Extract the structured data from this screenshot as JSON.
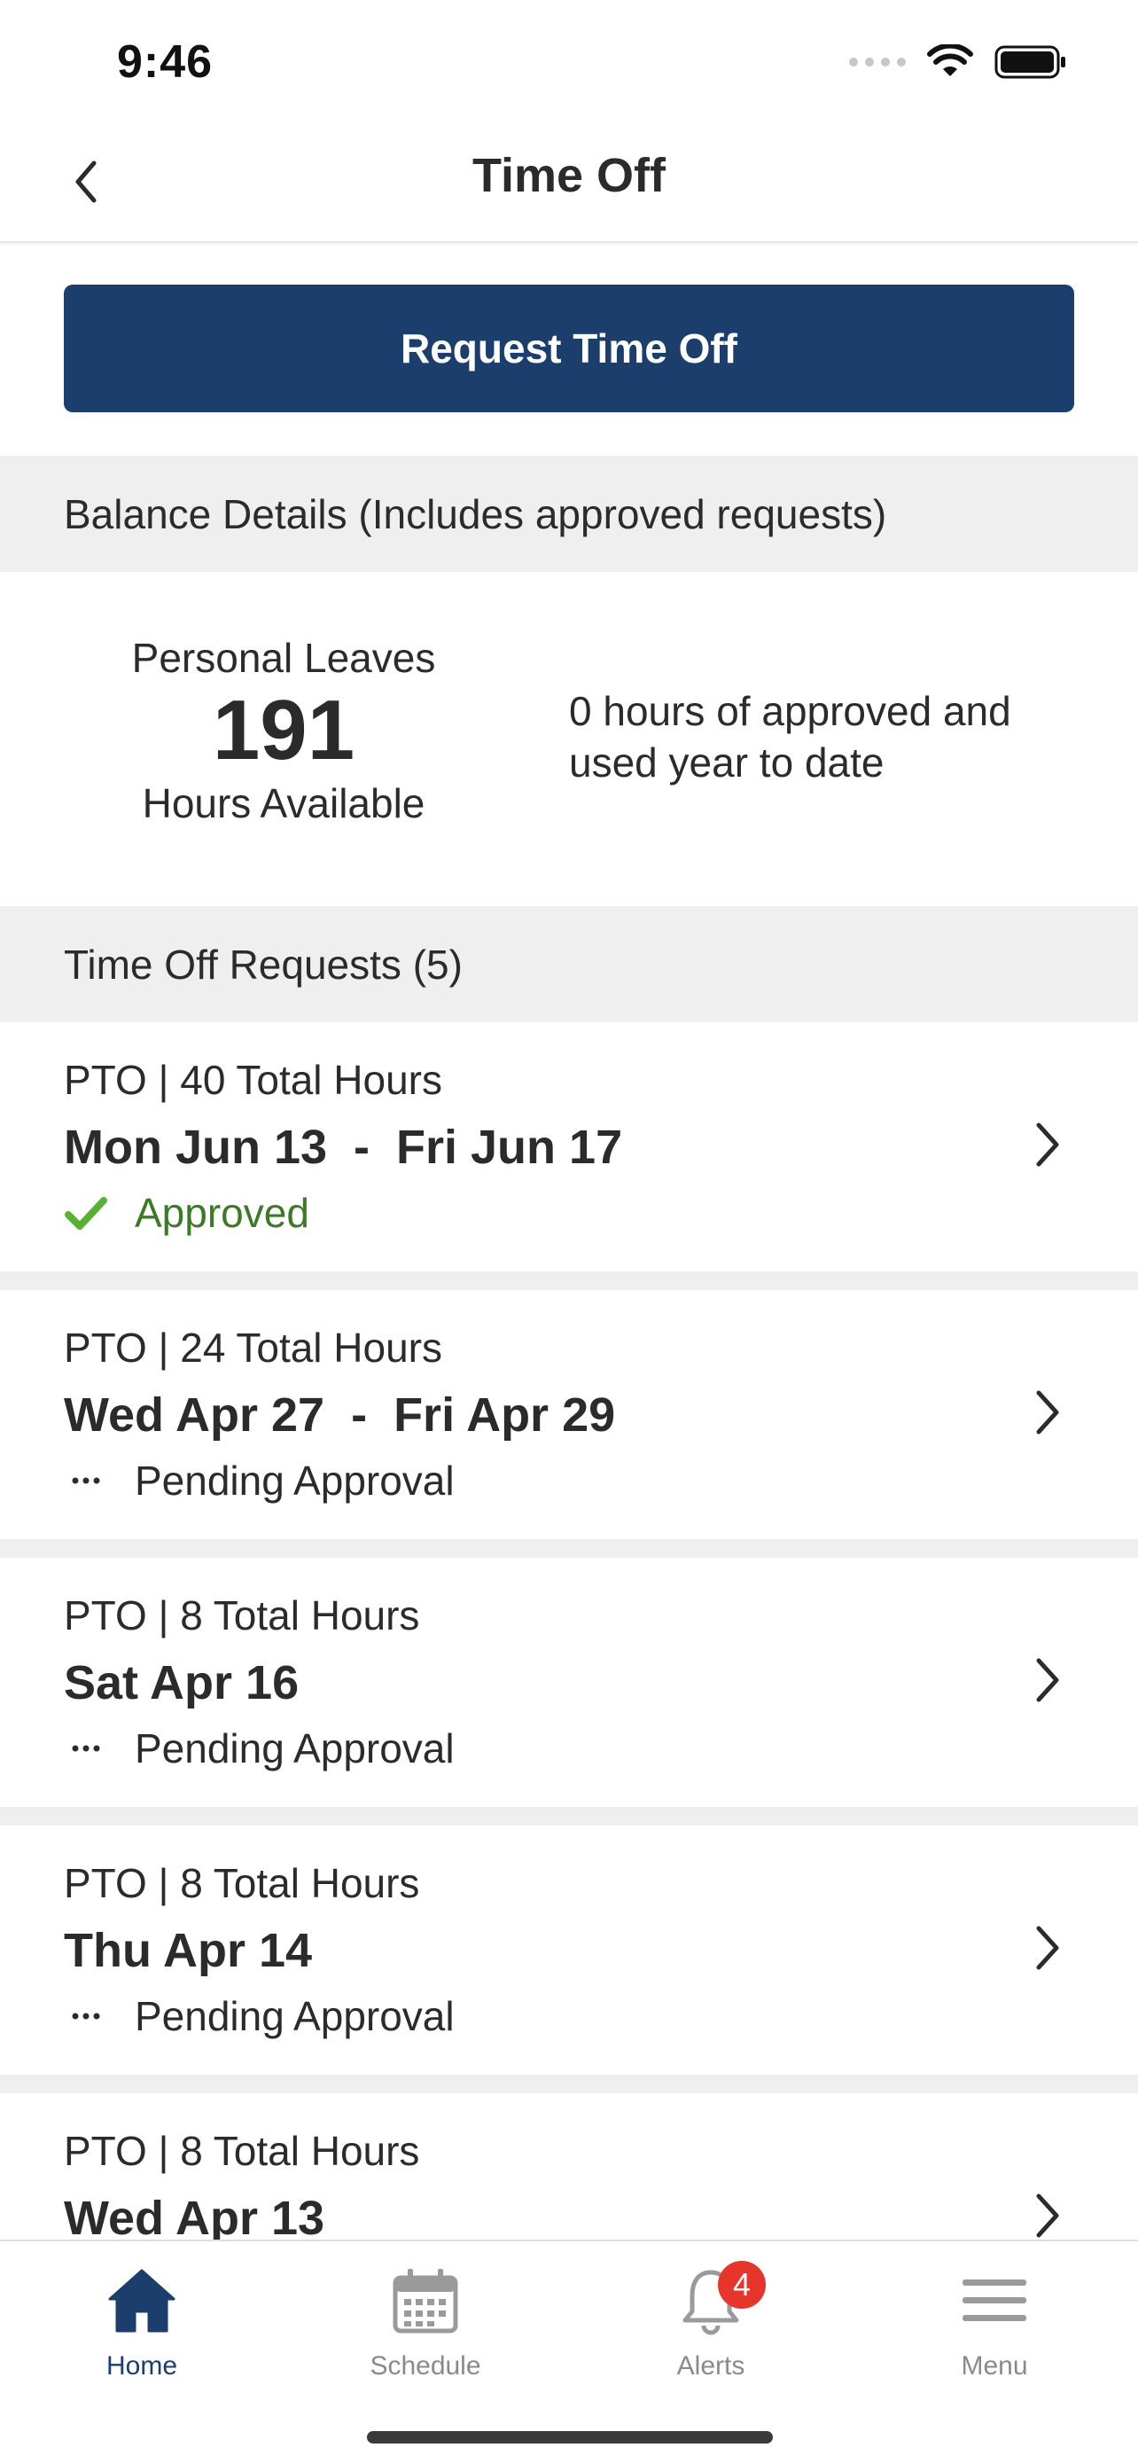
{
  "status_bar": {
    "time": "9:46"
  },
  "header": {
    "title": "Time Off"
  },
  "actions": {
    "request_label": "Request Time Off"
  },
  "balance": {
    "section_title": "Balance Details (Includes approved requests)",
    "type": "Personal Leaves",
    "value": "191",
    "unit": "Hours Available",
    "summary": "0 hours of approved and used year to date"
  },
  "requests": {
    "section_title": "Time Off Requests (5)",
    "items": [
      {
        "summary": "PTO | 40 Total Hours",
        "dates": "Mon Jun 13  -  Fri Jun 17",
        "status": "Approved"
      },
      {
        "summary": "PTO | 24 Total Hours",
        "dates": "Wed Apr 27  -  Fri Apr 29",
        "status": "Pending Approval"
      },
      {
        "summary": "PTO | 8 Total Hours",
        "dates": "Sat Apr 16",
        "status": "Pending Approval"
      },
      {
        "summary": "PTO | 8 Total Hours",
        "dates": "Thu Apr 14",
        "status": "Pending Approval"
      },
      {
        "summary": "PTO | 8 Total Hours",
        "dates": "Wed Apr 13",
        "status": ""
      }
    ]
  },
  "tabs": [
    {
      "label": "Home",
      "icon": "home-icon",
      "active": true
    },
    {
      "label": "Schedule",
      "icon": "calendar-icon",
      "active": false
    },
    {
      "label": "Alerts",
      "icon": "bell-icon",
      "active": false,
      "badge": "4"
    },
    {
      "label": "Menu",
      "icon": "menu-icon",
      "active": false
    }
  ],
  "colors": {
    "primary": "#1c3e6c",
    "approved": "#3d7a28",
    "approved_icon": "#5ab034",
    "badge": "#e8352b",
    "section_bg": "#efefef"
  }
}
